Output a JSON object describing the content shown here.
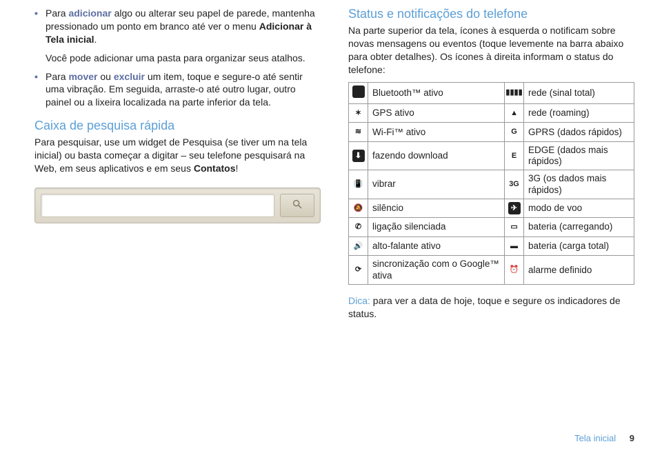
{
  "left": {
    "bullets": [
      {
        "pre": "Para ",
        "hl1": "adicionar",
        "mid1": " algo ou alterar seu papel de parede, mantenha pressionado um ponto em branco até ver o menu ",
        "bold1": "Adicionar à Tela inicial",
        "post1": ".",
        "line2": "Você pode adicionar uma pasta para organizar seus atalhos."
      },
      {
        "pre": "Para ",
        "hl1": "mover",
        "between": " ou ",
        "hl2": "excluir",
        "mid1": " um item, toque e segure-o até sentir uma vibração. Em seguida, arraste-o até outro lugar, outro painel ou a lixeira localizada na parte inferior da tela."
      }
    ],
    "search_h": "Caixa de pesquisa rápida",
    "search_p_pre": "Para pesquisar, use um widget de Pesquisa (se tiver um na tela inicial) ou basta começar a digitar – seu telefone pesquisará na Web, em seus aplicativos e em seus ",
    "search_p_bold": "Contatos",
    "search_p_post": "!"
  },
  "right": {
    "h": "Status e notificações do telefone",
    "p1": "Na parte superior da tela, ícones à esquerda o notificam sobre novas mensagens ou eventos (toque levemente na barra abaixo para obter detalhes). Os ícones à direita informam o status do telefone:",
    "rows": [
      {
        "l": "Bluetooth™ ativo",
        "r": "rede (sinal total)",
        "li": "bluetooth-icon",
        "ri": "signal-full-icon",
        "lg": "",
        "rg": "▮▮▮▮",
        "lf": true
      },
      {
        "l": "GPS ativo",
        "r": "rede (roaming)",
        "li": "gps-icon",
        "ri": "roaming-icon",
        "lg": "✶",
        "rg": "▲"
      },
      {
        "l": "Wi-Fi™ ativo",
        "r": "GPRS (dados rápidos)",
        "li": "wifi-icon",
        "ri": "gprs-icon",
        "lg": "≋",
        "rg": "G"
      },
      {
        "l": "fazendo download",
        "r": "EDGE (dados mais rápidos)",
        "li": "download-icon",
        "ri": "edge-icon",
        "lg": "⬇",
        "rg": "E",
        "lf": true
      },
      {
        "l": "vibrar",
        "r": "3G (os dados mais rápidos)",
        "li": "vibrate-icon",
        "ri": "threeg-icon",
        "lg": "📳",
        "rg": "3G"
      },
      {
        "l": "silêncio",
        "r": "modo de voo",
        "li": "silence-icon",
        "ri": "airplane-icon",
        "lg": "🔕",
        "rg": "✈",
        "rf": true
      },
      {
        "l": "ligação silenciada",
        "r": "bateria (carregando)",
        "li": "muted-call-icon",
        "ri": "battery-charging-icon",
        "lg": "✆",
        "rg": "▭"
      },
      {
        "l": "alto-falante ativo",
        "r": "bateria (carga total)",
        "li": "speaker-icon",
        "ri": "battery-full-icon",
        "lg": "🔊",
        "rg": "▬"
      },
      {
        "l": "sincronização com o Google™ ativa",
        "r": "alarme definido",
        "li": "sync-icon",
        "ri": "alarm-icon",
        "lg": "⟳",
        "rg": "⏰"
      }
    ],
    "tip_label": "Dica:",
    "tip_text": " para ver a data de hoje, toque e segure os indicadores de status."
  },
  "footer": {
    "section": "Tela inicial",
    "page": "9"
  }
}
